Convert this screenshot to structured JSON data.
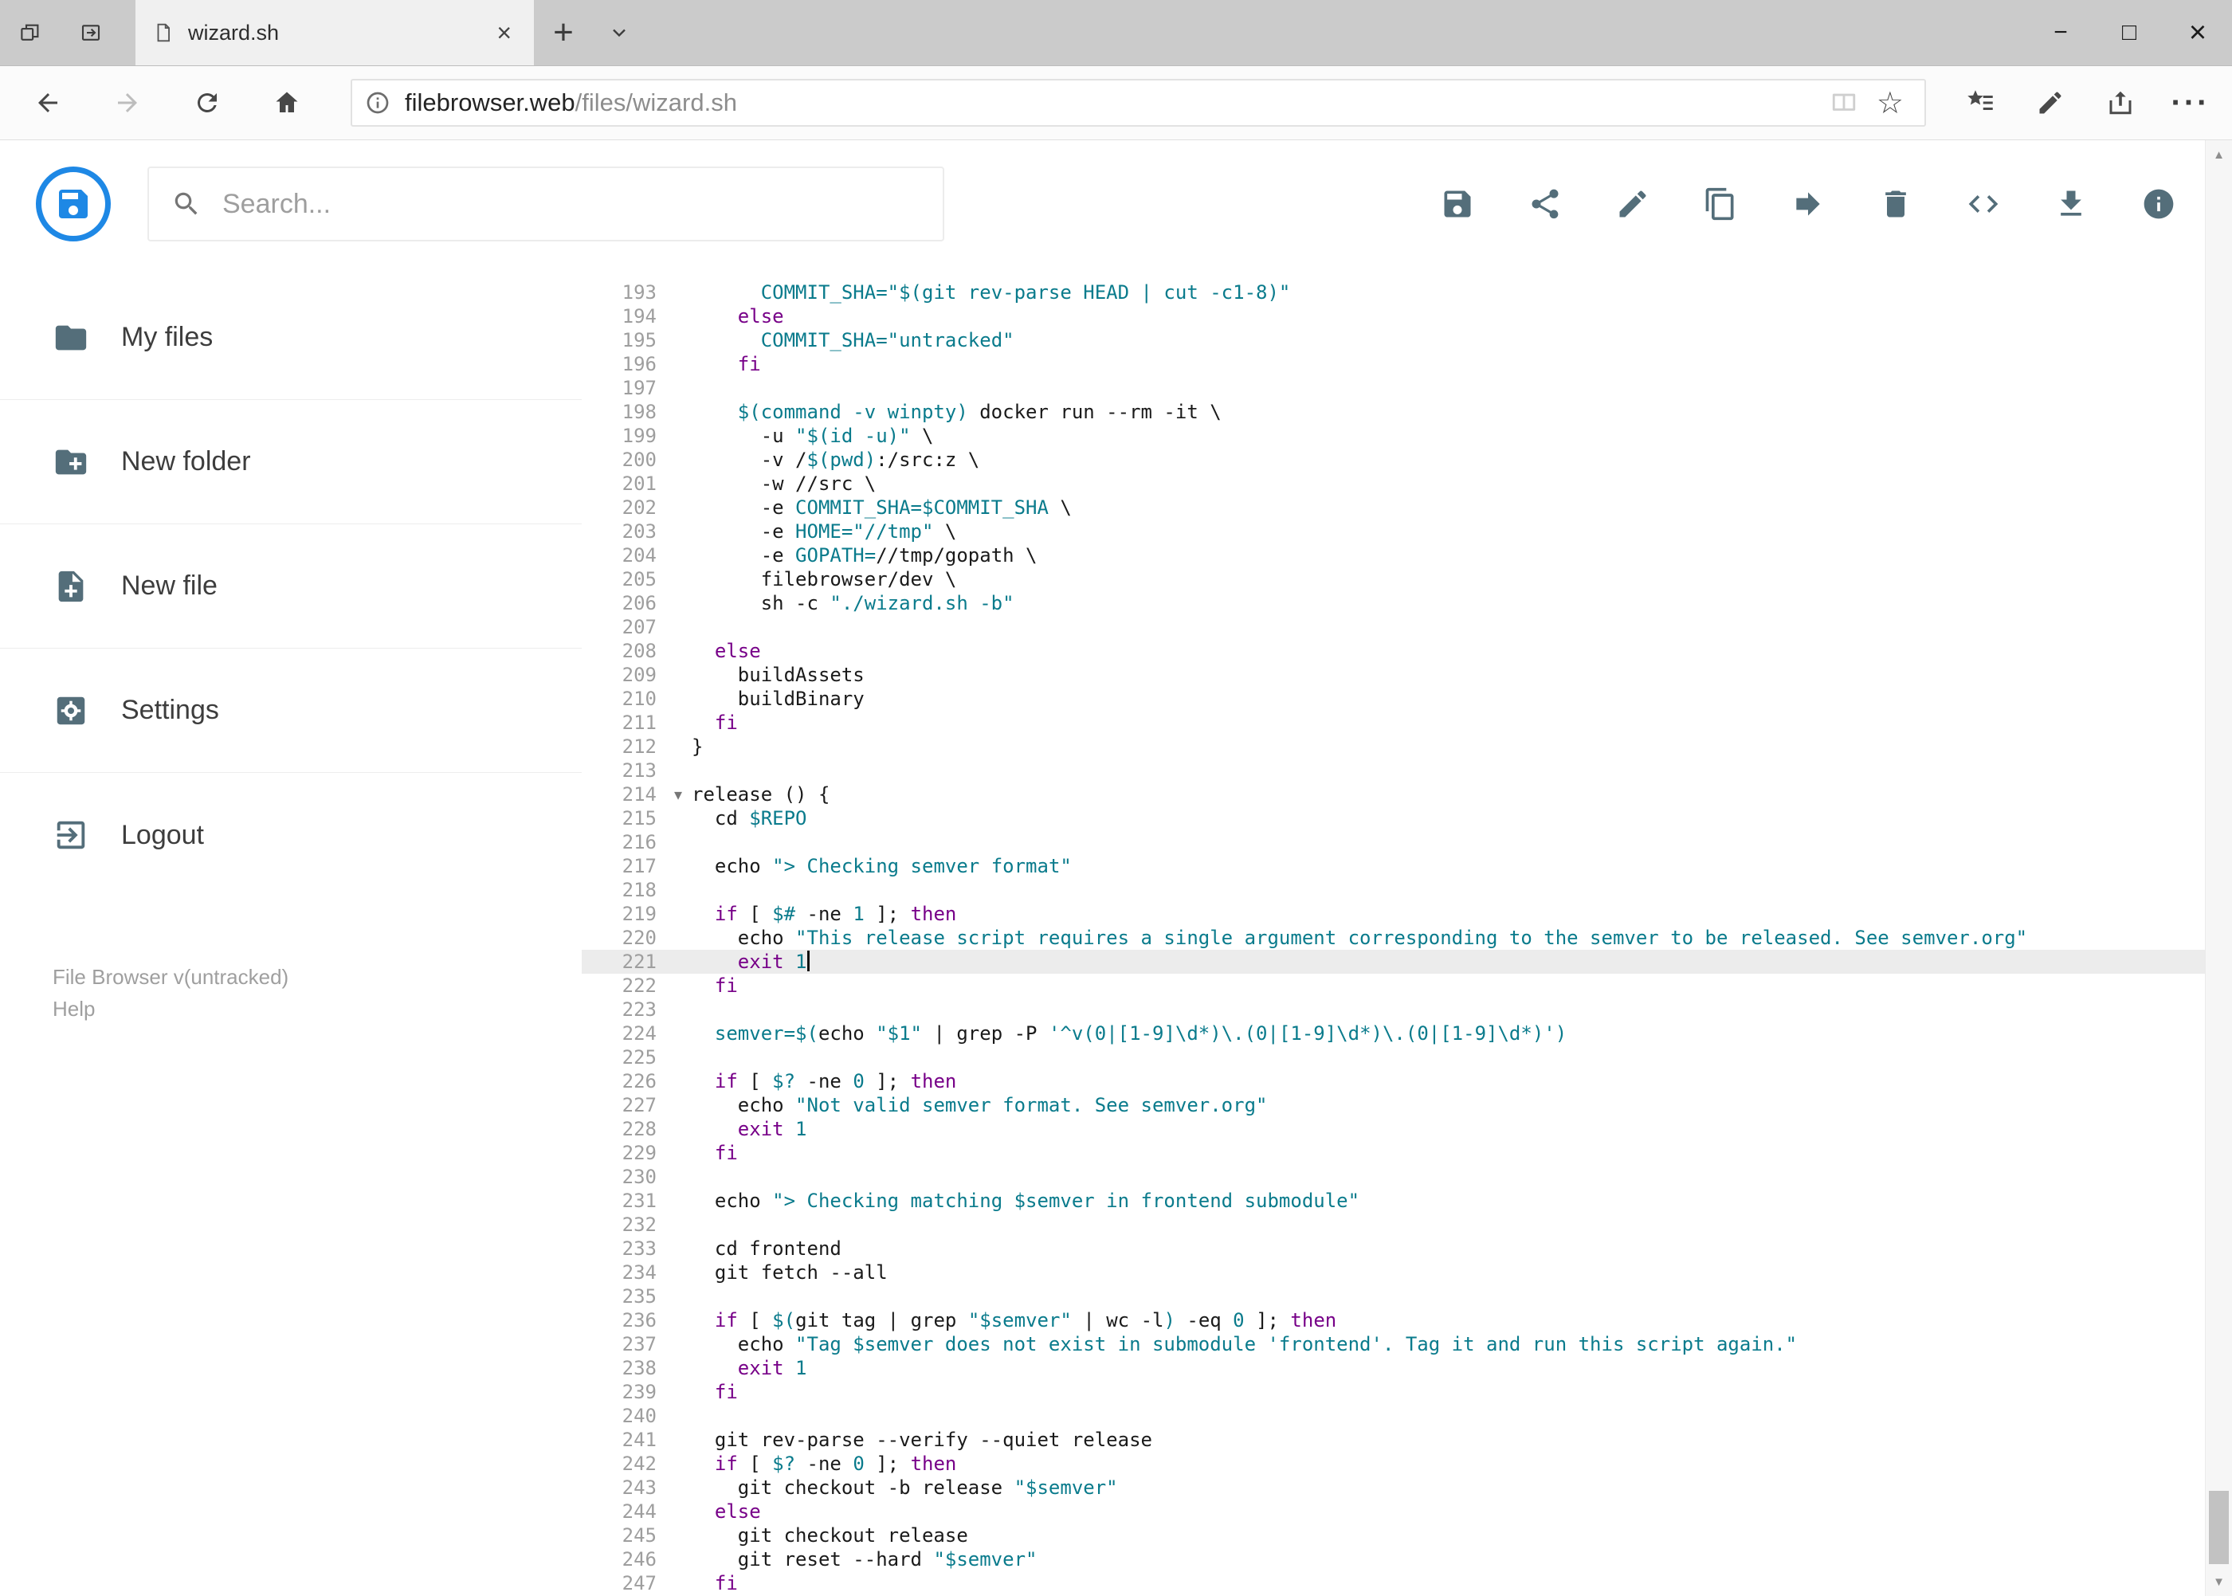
{
  "colors": {
    "accent": "#1E88E5",
    "icon": "#546E7A",
    "keyword": "#770088",
    "string": "#0A7B8C",
    "active_line": "#ECECEC"
  },
  "browser": {
    "tab_title": "wizard.sh",
    "url_host": "filebrowser.web",
    "url_path": "/files/wizard.sh",
    "glyphs": {
      "new_tab": "+",
      "close_tab": "×",
      "minimize": "−",
      "maximize": "□",
      "close": "×",
      "more": "···",
      "favorite": "☆"
    }
  },
  "app": {
    "search_placeholder": "Search...",
    "toolbar": [
      {
        "icon": "save-icon"
      },
      {
        "icon": "share-icon"
      },
      {
        "icon": "rename-icon"
      },
      {
        "icon": "copy-icon"
      },
      {
        "icon": "move-icon"
      },
      {
        "icon": "delete-icon"
      },
      {
        "icon": "source-code-icon"
      },
      {
        "icon": "download-icon"
      },
      {
        "icon": "info-icon"
      }
    ],
    "sidebar": {
      "items": [
        {
          "label": "My files",
          "icon": "folder-icon"
        },
        {
          "label": "New folder",
          "icon": "new-folder-icon"
        },
        {
          "label": "New file",
          "icon": "new-file-icon"
        },
        {
          "label": "Settings",
          "icon": "settings-icon"
        },
        {
          "label": "Logout",
          "icon": "logout-icon"
        }
      ],
      "version": "File Browser v(untracked)",
      "help": "Help"
    }
  },
  "editor": {
    "active_line": 221,
    "fold_icon": "▾",
    "scroll_glyphs": {
      "up": "▲",
      "down": "▼"
    },
    "lines": [
      {
        "n": 193,
        "t": [
          [
            "p",
            "      "
          ],
          [
            "s",
            "COMMIT_SHA=\"$(git rev-parse HEAD | cut -c1-8)\""
          ]
        ]
      },
      {
        "n": 194,
        "t": [
          [
            "p",
            "    "
          ],
          [
            "k",
            "else"
          ]
        ]
      },
      {
        "n": 195,
        "t": [
          [
            "p",
            "      "
          ],
          [
            "s",
            "COMMIT_SHA=\"untracked\""
          ]
        ]
      },
      {
        "n": 196,
        "t": [
          [
            "p",
            "    "
          ],
          [
            "k",
            "fi"
          ]
        ]
      },
      {
        "n": 197,
        "t": []
      },
      {
        "n": 198,
        "t": [
          [
            "p",
            "    "
          ],
          [
            "s",
            "$(command -v winpty)"
          ],
          [
            "p",
            " docker run --rm -it \\"
          ]
        ]
      },
      {
        "n": 199,
        "t": [
          [
            "p",
            "      -u "
          ],
          [
            "s",
            "\"$(id -u)\""
          ],
          [
            "p",
            " \\"
          ]
        ]
      },
      {
        "n": 200,
        "t": [
          [
            "p",
            "      -v /"
          ],
          [
            "s",
            "$(pwd)"
          ],
          [
            "p",
            ":/src:z \\"
          ]
        ]
      },
      {
        "n": 201,
        "t": [
          [
            "p",
            "      -w //src \\"
          ]
        ]
      },
      {
        "n": 202,
        "t": [
          [
            "p",
            "      -e "
          ],
          [
            "s",
            "COMMIT_SHA=$COMMIT_SHA"
          ],
          [
            "p",
            " \\"
          ]
        ]
      },
      {
        "n": 203,
        "t": [
          [
            "p",
            "      -e "
          ],
          [
            "s",
            "HOME=\"//tmp\""
          ],
          [
            "p",
            " \\"
          ]
        ]
      },
      {
        "n": 204,
        "t": [
          [
            "p",
            "      -e "
          ],
          [
            "s",
            "GOPATH="
          ],
          [
            "p",
            "//tmp/gopath \\"
          ]
        ]
      },
      {
        "n": 205,
        "t": [
          [
            "p",
            "      filebrowser/dev \\"
          ]
        ]
      },
      {
        "n": 206,
        "t": [
          [
            "p",
            "      sh -c "
          ],
          [
            "s",
            "\"./wizard.sh -b\""
          ]
        ]
      },
      {
        "n": 207,
        "t": []
      },
      {
        "n": 208,
        "t": [
          [
            "p",
            "  "
          ],
          [
            "k",
            "else"
          ]
        ]
      },
      {
        "n": 209,
        "t": [
          [
            "p",
            "    buildAssets"
          ]
        ]
      },
      {
        "n": 210,
        "t": [
          [
            "p",
            "    buildBinary"
          ]
        ]
      },
      {
        "n": 211,
        "t": [
          [
            "p",
            "  "
          ],
          [
            "k",
            "fi"
          ]
        ]
      },
      {
        "n": 212,
        "t": [
          [
            "p",
            "}"
          ]
        ]
      },
      {
        "n": 213,
        "t": []
      },
      {
        "n": 214,
        "fold": true,
        "t": [
          [
            "p",
            "release () {"
          ]
        ]
      },
      {
        "n": 215,
        "t": [
          [
            "p",
            "  cd "
          ],
          [
            "s",
            "$REPO"
          ]
        ]
      },
      {
        "n": 216,
        "t": []
      },
      {
        "n": 217,
        "t": [
          [
            "p",
            "  echo "
          ],
          [
            "s",
            "\"> Checking semver format\""
          ]
        ]
      },
      {
        "n": 218,
        "t": []
      },
      {
        "n": 219,
        "t": [
          [
            "p",
            "  "
          ],
          [
            "k",
            "if"
          ],
          [
            "p",
            " [ "
          ],
          [
            "s",
            "$#"
          ],
          [
            "p",
            " -ne "
          ],
          [
            "s",
            "1"
          ],
          [
            "p",
            " ]; "
          ],
          [
            "k",
            "then"
          ]
        ]
      },
      {
        "n": 220,
        "t": [
          [
            "p",
            "    echo "
          ],
          [
            "s",
            "\"This release script requires a single argument corresponding to the semver to be released. See semver.org\""
          ]
        ]
      },
      {
        "n": 221,
        "cursor": true,
        "t": [
          [
            "p",
            "    "
          ],
          [
            "k",
            "exit"
          ],
          [
            "p",
            " "
          ],
          [
            "s",
            "1"
          ]
        ]
      },
      {
        "n": 222,
        "t": [
          [
            "p",
            "  "
          ],
          [
            "k",
            "fi"
          ]
        ]
      },
      {
        "n": 223,
        "t": []
      },
      {
        "n": 224,
        "t": [
          [
            "p",
            "  "
          ],
          [
            "s",
            "semver=$("
          ],
          [
            "p",
            "echo "
          ],
          [
            "s",
            "\"$1\""
          ],
          [
            "p",
            " | grep -P "
          ],
          [
            "s",
            "'^v(0|[1-9]\\d*)\\.(0|[1-9]\\d*)\\.(0|[1-9]\\d*)'"
          ],
          [
            "s",
            ")"
          ]
        ]
      },
      {
        "n": 225,
        "t": []
      },
      {
        "n": 226,
        "t": [
          [
            "p",
            "  "
          ],
          [
            "k",
            "if"
          ],
          [
            "p",
            " [ "
          ],
          [
            "s",
            "$?"
          ],
          [
            "p",
            " -ne "
          ],
          [
            "s",
            "0"
          ],
          [
            "p",
            " ]; "
          ],
          [
            "k",
            "then"
          ]
        ]
      },
      {
        "n": 227,
        "t": [
          [
            "p",
            "    echo "
          ],
          [
            "s",
            "\"Not valid semver format. See semver.org\""
          ]
        ]
      },
      {
        "n": 228,
        "t": [
          [
            "p",
            "    "
          ],
          [
            "k",
            "exit"
          ],
          [
            "p",
            " "
          ],
          [
            "s",
            "1"
          ]
        ]
      },
      {
        "n": 229,
        "t": [
          [
            "p",
            "  "
          ],
          [
            "k",
            "fi"
          ]
        ]
      },
      {
        "n": 230,
        "t": []
      },
      {
        "n": 231,
        "t": [
          [
            "p",
            "  echo "
          ],
          [
            "s",
            "\"> Checking matching $semver in frontend submodule\""
          ]
        ]
      },
      {
        "n": 232,
        "t": []
      },
      {
        "n": 233,
        "t": [
          [
            "p",
            "  cd frontend"
          ]
        ]
      },
      {
        "n": 234,
        "t": [
          [
            "p",
            "  git fetch --all"
          ]
        ]
      },
      {
        "n": 235,
        "t": []
      },
      {
        "n": 236,
        "t": [
          [
            "p",
            "  "
          ],
          [
            "k",
            "if"
          ],
          [
            "p",
            " [ "
          ],
          [
            "s",
            "$("
          ],
          [
            "p",
            "git tag | grep "
          ],
          [
            "s",
            "\"$semver\""
          ],
          [
            "p",
            " | wc -l"
          ],
          [
            "s",
            ")"
          ],
          [
            "p",
            " -eq "
          ],
          [
            "s",
            "0"
          ],
          [
            "p",
            " ]; "
          ],
          [
            "k",
            "then"
          ]
        ]
      },
      {
        "n": 237,
        "t": [
          [
            "p",
            "    echo "
          ],
          [
            "s",
            "\"Tag $semver does not exist in submodule 'frontend'. Tag it and run this script again.\""
          ]
        ]
      },
      {
        "n": 238,
        "t": [
          [
            "p",
            "    "
          ],
          [
            "k",
            "exit"
          ],
          [
            "p",
            " "
          ],
          [
            "s",
            "1"
          ]
        ]
      },
      {
        "n": 239,
        "t": [
          [
            "p",
            "  "
          ],
          [
            "k",
            "fi"
          ]
        ]
      },
      {
        "n": 240,
        "t": []
      },
      {
        "n": 241,
        "t": [
          [
            "p",
            "  git rev-parse --verify --quiet release"
          ]
        ]
      },
      {
        "n": 242,
        "t": [
          [
            "p",
            "  "
          ],
          [
            "k",
            "if"
          ],
          [
            "p",
            " [ "
          ],
          [
            "s",
            "$?"
          ],
          [
            "p",
            " -ne "
          ],
          [
            "s",
            "0"
          ],
          [
            "p",
            " ]; "
          ],
          [
            "k",
            "then"
          ]
        ]
      },
      {
        "n": 243,
        "t": [
          [
            "p",
            "    git checkout -b release "
          ],
          [
            "s",
            "\"$semver\""
          ]
        ]
      },
      {
        "n": 244,
        "t": [
          [
            "p",
            "  "
          ],
          [
            "k",
            "else"
          ]
        ]
      },
      {
        "n": 245,
        "t": [
          [
            "p",
            "    git checkout release"
          ]
        ]
      },
      {
        "n": 246,
        "t": [
          [
            "p",
            "    git reset --hard "
          ],
          [
            "s",
            "\"$semver\""
          ]
        ]
      },
      {
        "n": 247,
        "t": [
          [
            "p",
            "  "
          ],
          [
            "k",
            "fi"
          ]
        ]
      }
    ]
  }
}
